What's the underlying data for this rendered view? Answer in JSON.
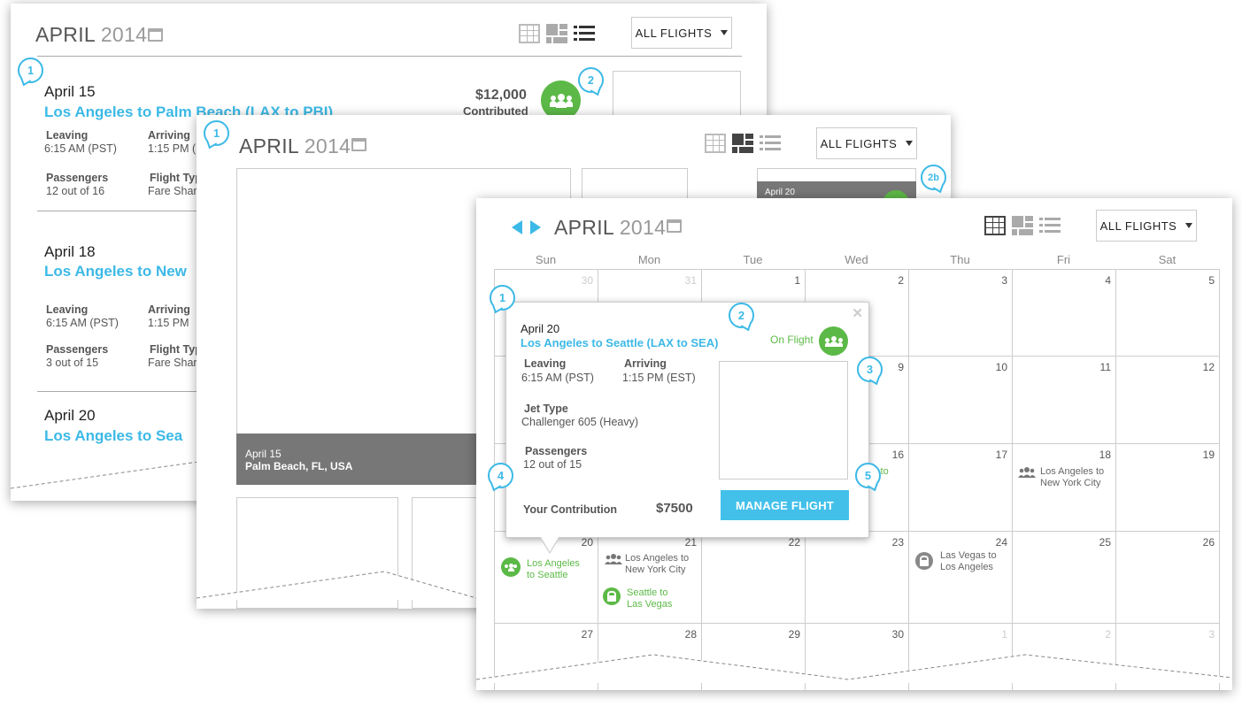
{
  "panel1": {
    "month": "APRIL",
    "year": "2014",
    "dropdown": "ALL  FLIGHTS",
    "badges": [
      "1",
      "2"
    ],
    "flights": [
      {
        "date": "April 15",
        "route": "Los Angeles to Palm Beach (LAX to PBI)",
        "leaving_label": "Leaving",
        "leaving": "6:15 AM (PST)",
        "arriving_label": "Arriving",
        "arriving": "1:15 PM (E",
        "passengers_label": "Passengers",
        "passengers": "12 out of 16",
        "type_label": "Flight Typ",
        "type": "Fare Shar",
        "amount": "$12,000",
        "amount_label": "Contributed"
      },
      {
        "date": "April 18",
        "route": "Los Angeles to New",
        "leaving_label": "Leaving",
        "leaving": "6:15 AM (PST)",
        "arriving_label": "Arriving",
        "arriving": "1:15 PM",
        "passengers_label": "Passengers",
        "passengers": "3 out of 15",
        "type_label": "Flight Typ",
        "type": "Fare Shar"
      },
      {
        "date": "April 20",
        "route": "Los Angeles to Sea"
      }
    ]
  },
  "panel2": {
    "month": "APRIL",
    "year": "2014",
    "dropdown": "ALL  FLIGHTS",
    "badges": [
      "1",
      "2b"
    ],
    "feature": {
      "date": "April 15",
      "place": "Palm Beach, FL, USA"
    },
    "tile": {
      "date": "April 20"
    }
  },
  "panel3": {
    "month": "APRIL",
    "year": "2014",
    "dropdown": "ALL  FLIGHTS",
    "weekdays": [
      "Sun",
      "Mon",
      "Tue",
      "Wed",
      "Thu",
      "Fri",
      "Sat"
    ],
    "rows": [
      [
        "30",
        "31",
        "1",
        "2",
        "3",
        "4",
        "5"
      ],
      [
        "",
        "",
        "",
        "9",
        "10",
        "11",
        "12"
      ],
      [
        "",
        "",
        "",
        "16",
        "17",
        "18",
        "19"
      ],
      [
        "20",
        "21",
        "22",
        "23",
        "24",
        "25",
        "26"
      ],
      [
        "27",
        "28",
        "29",
        "30",
        "1",
        "2",
        "3"
      ]
    ],
    "events": {
      "sun20": "Los Angeles\nto Seattle",
      "mon21a": "Los Angeles to\nNew York City",
      "mon21b": "Seattle to\nLas Vegas",
      "wed16": "s to\nn",
      "fri18": "Los Angeles to\nNew York City",
      "thu24": "Las Vegas to\nLos Angeles"
    },
    "popup": {
      "date": "April 20",
      "route": "Los Angeles to Seattle (LAX to SEA)",
      "status": "On Flight",
      "leaving_label": "Leaving",
      "leaving": "6:15 AM (PST)",
      "arriving_label": "Arriving",
      "arriving": "1:15 PM (EST)",
      "jet_label": "Jet Type",
      "jet": "Challenger 605 (Heavy)",
      "passengers_label": "Passengers",
      "passengers": "12 out of 15",
      "contribution_label": "Your Contribution",
      "contribution": "$7500",
      "button": "MANAGE FLIGHT",
      "close": "✕"
    },
    "badges": [
      "1",
      "2",
      "3",
      "4",
      "5"
    ]
  },
  "colors": {
    "accent": "#3cb9e6",
    "green": "#5cb947",
    "dark_bar": "#777777"
  }
}
